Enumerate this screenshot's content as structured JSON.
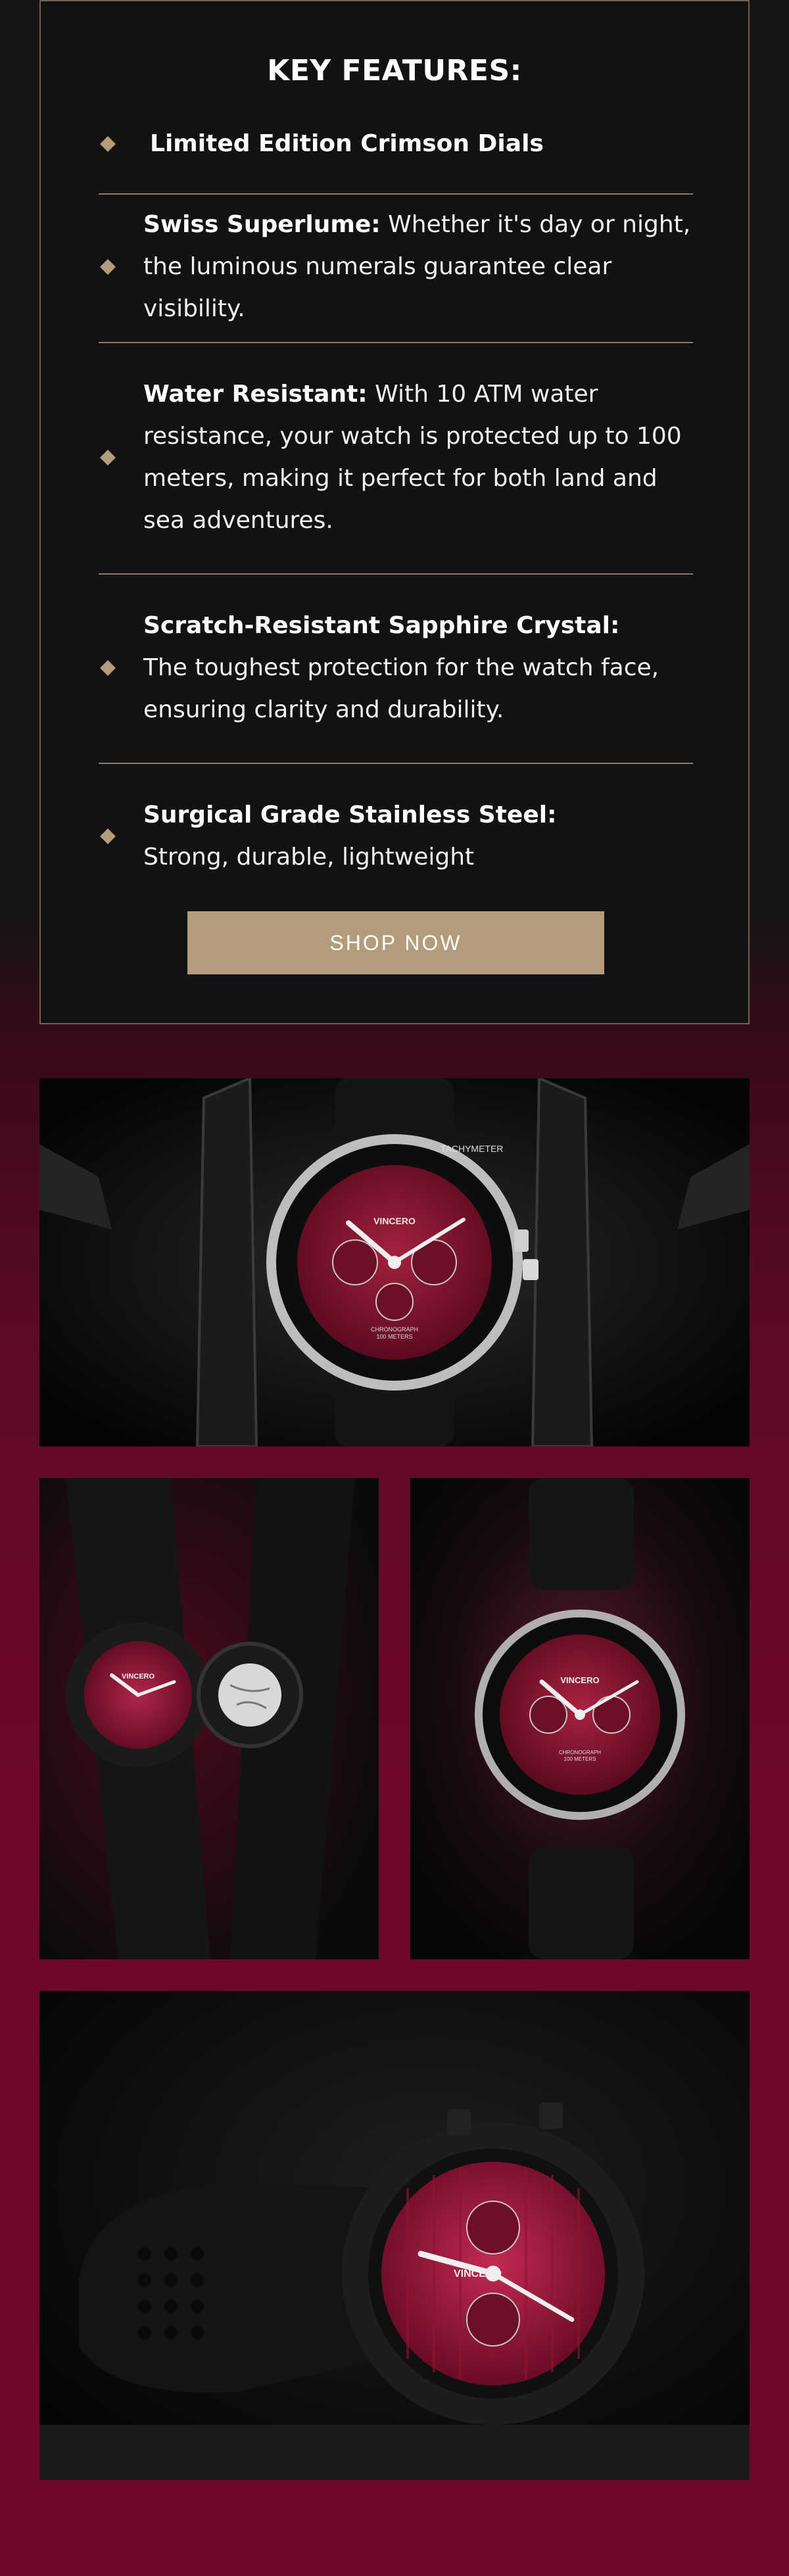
{
  "features": {
    "title": "KEY FEATURES:",
    "items": [
      {
        "label": "Limited Edition Crimson Dials",
        "desc": ""
      },
      {
        "label": "Swiss Superlume:",
        "desc": "Whether it's day or night, the luminous numerals guarantee clear visibility."
      },
      {
        "label": "Water Resistant:",
        "desc": "With 10 ATM water resistance, your watch is protected up to 100 meters, making it perfect for both land and sea adventures."
      },
      {
        "label": "Scratch-Resistant Sapphire Crystal:",
        "desc": "The toughest protection for the watch face, ensuring clarity and durability."
      },
      {
        "label": "Surgical Grade Stainless Steel:",
        "desc": "Strong, durable, lightweight"
      }
    ],
    "bullet_icon": "diamond-icon",
    "shop_button": "SHOP NOW"
  },
  "colors": {
    "accent": "#b39c7b",
    "card_bg": "#121212",
    "crimson": "#7a0f2e"
  },
  "photos": {
    "photo_1": {
      "brand": "VINCERO",
      "bezel": "TACHYMETER",
      "subdial": "CHRONOGRAPH",
      "depth": "100 METERS"
    },
    "photo_2": {
      "brand": "VINCERO"
    },
    "photo_3": {
      "brand": "VINCERO",
      "subdial": "CHRONOGRAPH",
      "depth": "100 METERS"
    },
    "photo_4": {
      "brand": "VINCERO"
    }
  }
}
